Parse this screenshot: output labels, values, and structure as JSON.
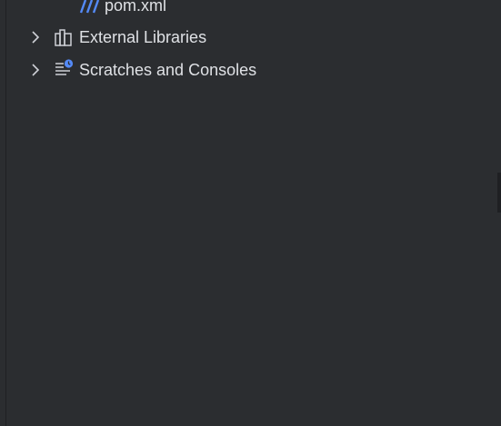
{
  "project_tree": {
    "items": [
      {
        "label": "pom.xml",
        "icon": "maven-icon"
      },
      {
        "label": "External Libraries",
        "icon": "libraries-icon"
      },
      {
        "label": "Scratches and Consoles",
        "icon": "scratches-icon"
      }
    ]
  },
  "colors": {
    "background": "#2b2d30",
    "text": "#dfe1e5",
    "icon": "#ced0d6",
    "accent": "#548af7"
  }
}
